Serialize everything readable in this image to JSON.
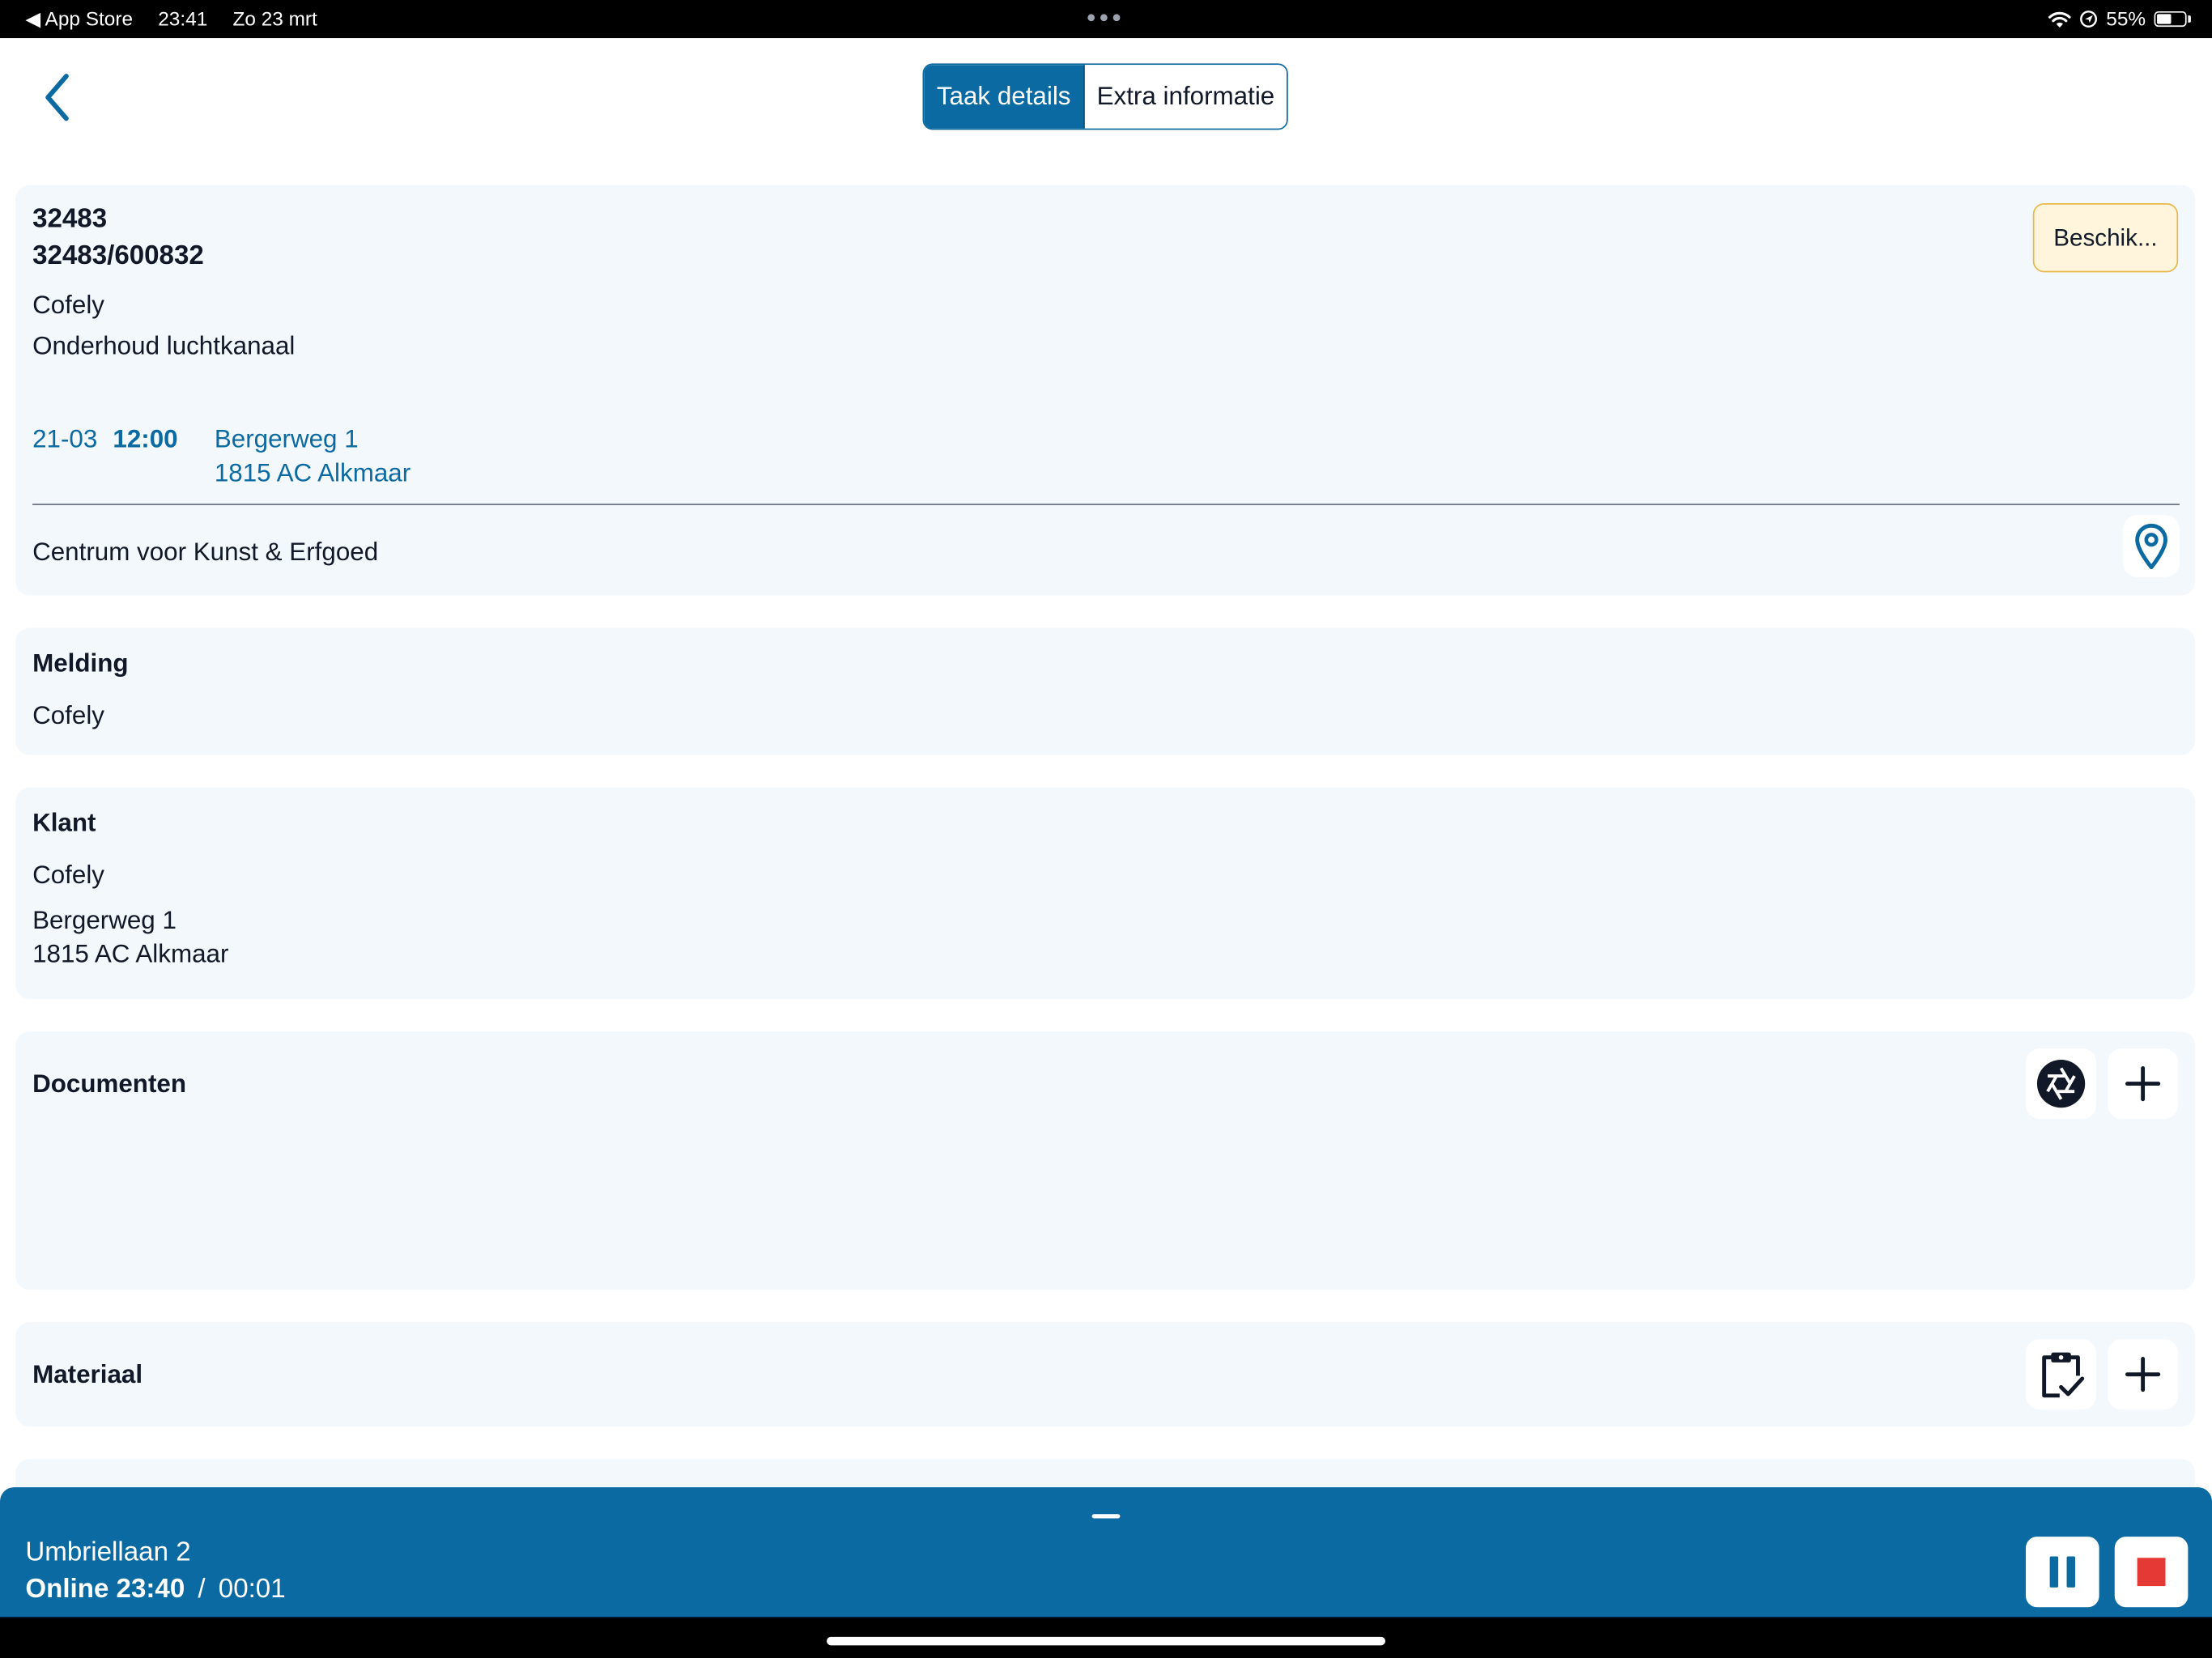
{
  "status_bar": {
    "back_app": "◀ App Store",
    "time": "23:41",
    "date": "Zo 23 mrt",
    "battery": "55%",
    "battery_level": 0.55
  },
  "header": {
    "tabs": [
      {
        "label": "Taak details",
        "active": true
      },
      {
        "label": "Extra informatie",
        "active": false
      }
    ]
  },
  "task": {
    "number": "32483",
    "reference": "32483/600832",
    "company": "Cofely",
    "description": "Onderhoud luchtkanaal",
    "status": "Beschik...",
    "date": "21-03",
    "time": "12:00",
    "address_line1": "Bergerweg 1",
    "address_line2": "1815 AC Alkmaar",
    "location_name": "Centrum voor Kunst & Erfgoed"
  },
  "melding": {
    "title": "Melding",
    "value": "Cofely"
  },
  "klant": {
    "title": "Klant",
    "name": "Cofely",
    "address_line1": "Bergerweg 1",
    "address_line2": "1815 AC Alkmaar"
  },
  "documenten": {
    "title": "Documenten"
  },
  "materiaal": {
    "title": "Materiaal"
  },
  "bottom_bar": {
    "location": "Umbriellaan 2",
    "status": "Online 23:40",
    "separator": "/",
    "duration": "00:01"
  },
  "colors": {
    "accent": "#0b6aa2",
    "card_bg": "#f3f8fd",
    "status_chip_bg": "#fff5dc",
    "status_chip_border": "#e8b84c",
    "stop_red": "#e53935"
  }
}
